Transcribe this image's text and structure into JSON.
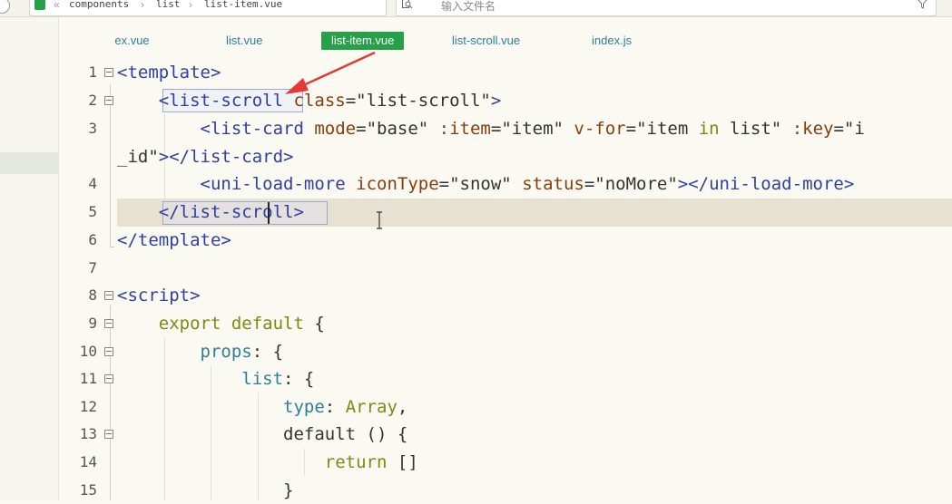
{
  "breadcrumb": {
    "items": [
      "components",
      "list",
      "list-item.vue"
    ],
    "separator": "›",
    "back_glyph": "«"
  },
  "search": {
    "placeholder": "输入文件名"
  },
  "tabs": [
    {
      "label": "index.vue",
      "active": false
    },
    {
      "label": "list.vue",
      "active": false
    },
    {
      "label": "list-item.vue",
      "active": true
    },
    {
      "label": "list-scroll.vue",
      "active": false
    },
    {
      "label": "index.js",
      "active": false
    }
  ],
  "editor": {
    "line_numbers": [
      "1",
      "2",
      "3",
      "4",
      "5",
      "6",
      "7",
      "8",
      "9",
      "10",
      "11",
      "12",
      "13",
      "14",
      "15"
    ],
    "cursor_line": 5
  },
  "colors": {
    "accent": "#27a147",
    "tag": "#2f3fa2",
    "attribute": "#8a3c0b",
    "keyword": "#7b8a12",
    "property": "#2e7f96",
    "arrow": "#e53935"
  }
}
